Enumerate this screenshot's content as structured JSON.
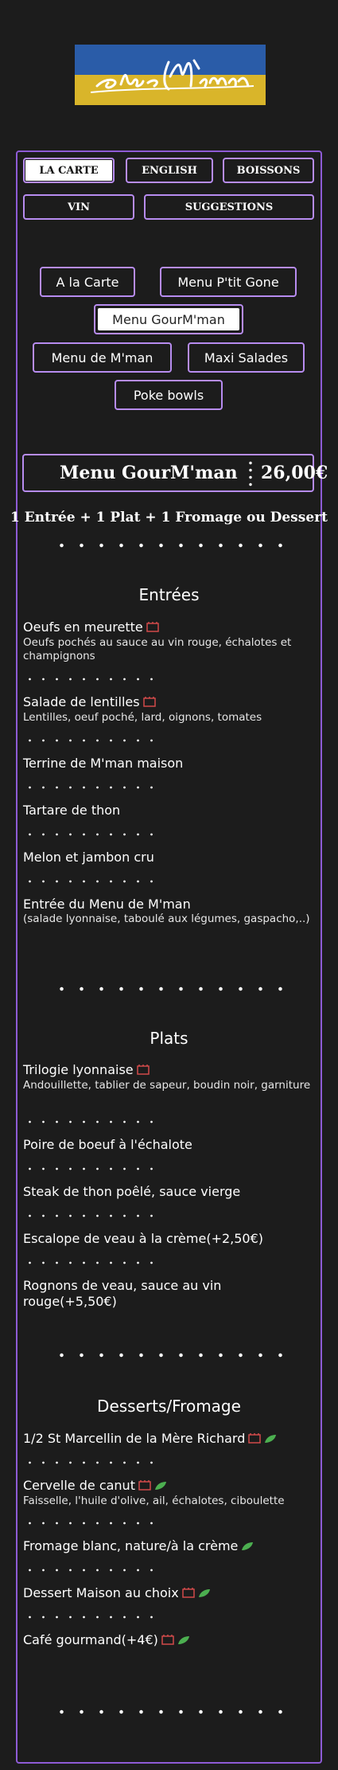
{
  "logo": {
    "text": "Chez M'man",
    "colors": {
      "top": "#2a5ca8",
      "bottom": "#d9b52a"
    }
  },
  "tabs": [
    {
      "label": "LA CARTE",
      "active": true
    },
    {
      "label": "ENGLISH",
      "active": false
    },
    {
      "label": "BOISSONS",
      "active": false
    },
    {
      "label": "VIN",
      "active": false
    },
    {
      "label": "SUGGESTIONS",
      "active": false
    }
  ],
  "submenus": [
    {
      "label": "A la Carte",
      "active": false
    },
    {
      "label": "Menu P'tit Gone",
      "active": false
    },
    {
      "label": "Menu GourM'man",
      "active": true
    },
    {
      "label": "Menu de M'man",
      "active": false
    },
    {
      "label": "Maxi Salades",
      "active": false
    },
    {
      "label": "Poke bowls",
      "active": false
    }
  ],
  "menu": {
    "name": "Menu GourM'man",
    "price": "26,00€",
    "formula": "1 Entrée + 1 Plat + 1 Fromage ou Dessert"
  },
  "sections": {
    "entrees": {
      "title": "Entrées",
      "items": [
        {
          "name": "Oeufs en meurette",
          "desc": "Oeufs pochés au sauce au vin rouge, échalotes et champignons",
          "icons": [
            "lyon-icon"
          ]
        },
        {
          "name": "Salade de lentilles",
          "desc": "Lentilles, oeuf poché, lard, oignons, tomates",
          "icons": [
            "lyon-icon"
          ]
        },
        {
          "name": "Terrine de M'man maison",
          "desc": "",
          "icons": []
        },
        {
          "name": "Tartare de thon",
          "desc": "",
          "icons": []
        },
        {
          "name": "Melon et jambon cru",
          "desc": "",
          "icons": []
        },
        {
          "name": "Entrée du Menu de M'man",
          "desc": "(salade lyonnaise, taboulé aux légumes, gaspacho,..)",
          "icons": []
        }
      ]
    },
    "plats": {
      "title": "Plats",
      "items": [
        {
          "name": "Trilogie lyonnaise",
          "desc": "Andouillette, tablier de sapeur, boudin noir, garniture",
          "icons": [
            "lyon-icon"
          ]
        },
        {
          "name": "Poire de boeuf à l'échalote",
          "desc": "",
          "icons": []
        },
        {
          "name": "Steak de thon poêlé, sauce vierge",
          "desc": "",
          "icons": []
        },
        {
          "name": "Escalope de veau à la crème(+2,50€)",
          "desc": "",
          "icons": []
        },
        {
          "name": "Rognons de veau, sauce au vin rouge(+5,50€)",
          "desc": "",
          "icons": []
        }
      ]
    },
    "desserts": {
      "title": "Desserts/Fromage",
      "items": [
        {
          "name": "1/2 St Marcellin de la Mère Richard",
          "desc": "",
          "icons": [
            "lyon-icon",
            "leaf-icon"
          ]
        },
        {
          "name": "Cervelle de canut",
          "desc": "Faisselle, l'huile d'olive, ail, échalotes, ciboulette",
          "icons": [
            "lyon-icon",
            "leaf-icon"
          ]
        },
        {
          "name": "Fromage blanc, nature/à la crème",
          "desc": "",
          "icons": [
            "leaf-icon"
          ]
        },
        {
          "name": "Dessert Maison au choix",
          "desc": "",
          "icons": [
            "lyon-icon",
            "leaf-icon"
          ]
        },
        {
          "name": "Café gourmand(+4€)",
          "desc": "",
          "icons": [
            "lyon-icon",
            "leaf-icon"
          ]
        }
      ]
    }
  },
  "colors": {
    "accent": "#b78cf0",
    "background": "#1c1c1c",
    "lyon_icon": "#d24a4a",
    "leaf_icon": "#4caf50"
  }
}
